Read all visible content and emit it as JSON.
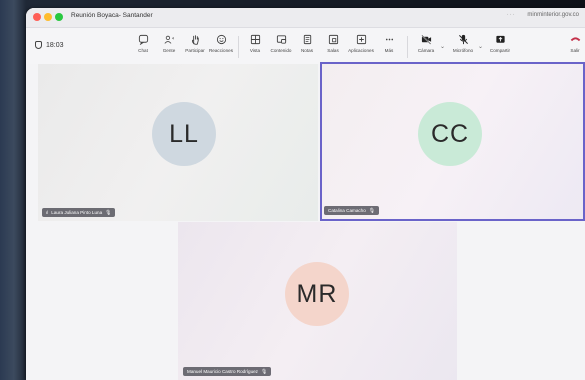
{
  "window": {
    "title": "Reunión Boyaca- Santander",
    "right_text": "minminterior.gov.co"
  },
  "toolbar": {
    "timer": "18:03",
    "items": [
      {
        "label": "Chat",
        "icon": "chat-icon"
      },
      {
        "label": "Gente",
        "icon": "people-icon",
        "badge": "4"
      },
      {
        "label": "Participar",
        "icon": "raise-hand-icon"
      },
      {
        "label": "Reacciones",
        "icon": "emoji-icon"
      },
      {
        "label": "Vista",
        "icon": "view-grid-icon"
      },
      {
        "label": "Contenido",
        "icon": "content-icon"
      },
      {
        "label": "Notas",
        "icon": "notes-icon"
      },
      {
        "label": "Salas",
        "icon": "breakout-rooms-icon"
      },
      {
        "label": "Aplicaciones",
        "icon": "apps-icon"
      },
      {
        "label": "Más",
        "icon": "more-icon"
      },
      {
        "label": "Cámara",
        "icon": "camera-off-icon"
      },
      {
        "label": "Micrófono",
        "icon": "mic-off-icon"
      },
      {
        "label": "Compartir",
        "icon": "share-icon"
      },
      {
        "label": "Salir",
        "icon": "leave-icon"
      }
    ]
  },
  "participants": [
    {
      "initials": "LL",
      "name": "Laura Juliana Pinto Luna",
      "muted": true,
      "avatar_color": "#cfd8e0"
    },
    {
      "initials": "CC",
      "name": "Catalina Camacho",
      "muted": true,
      "active_speaker": true,
      "avatar_color": "#c9ead7"
    },
    {
      "initials": "MR",
      "name": "Manuel Mauricio Castro Rodríguez",
      "muted": true,
      "avatar_color": "#f4d5cb"
    }
  ],
  "colors": {
    "active_border": "#6a63c9",
    "leave_red": "#c4314b"
  }
}
